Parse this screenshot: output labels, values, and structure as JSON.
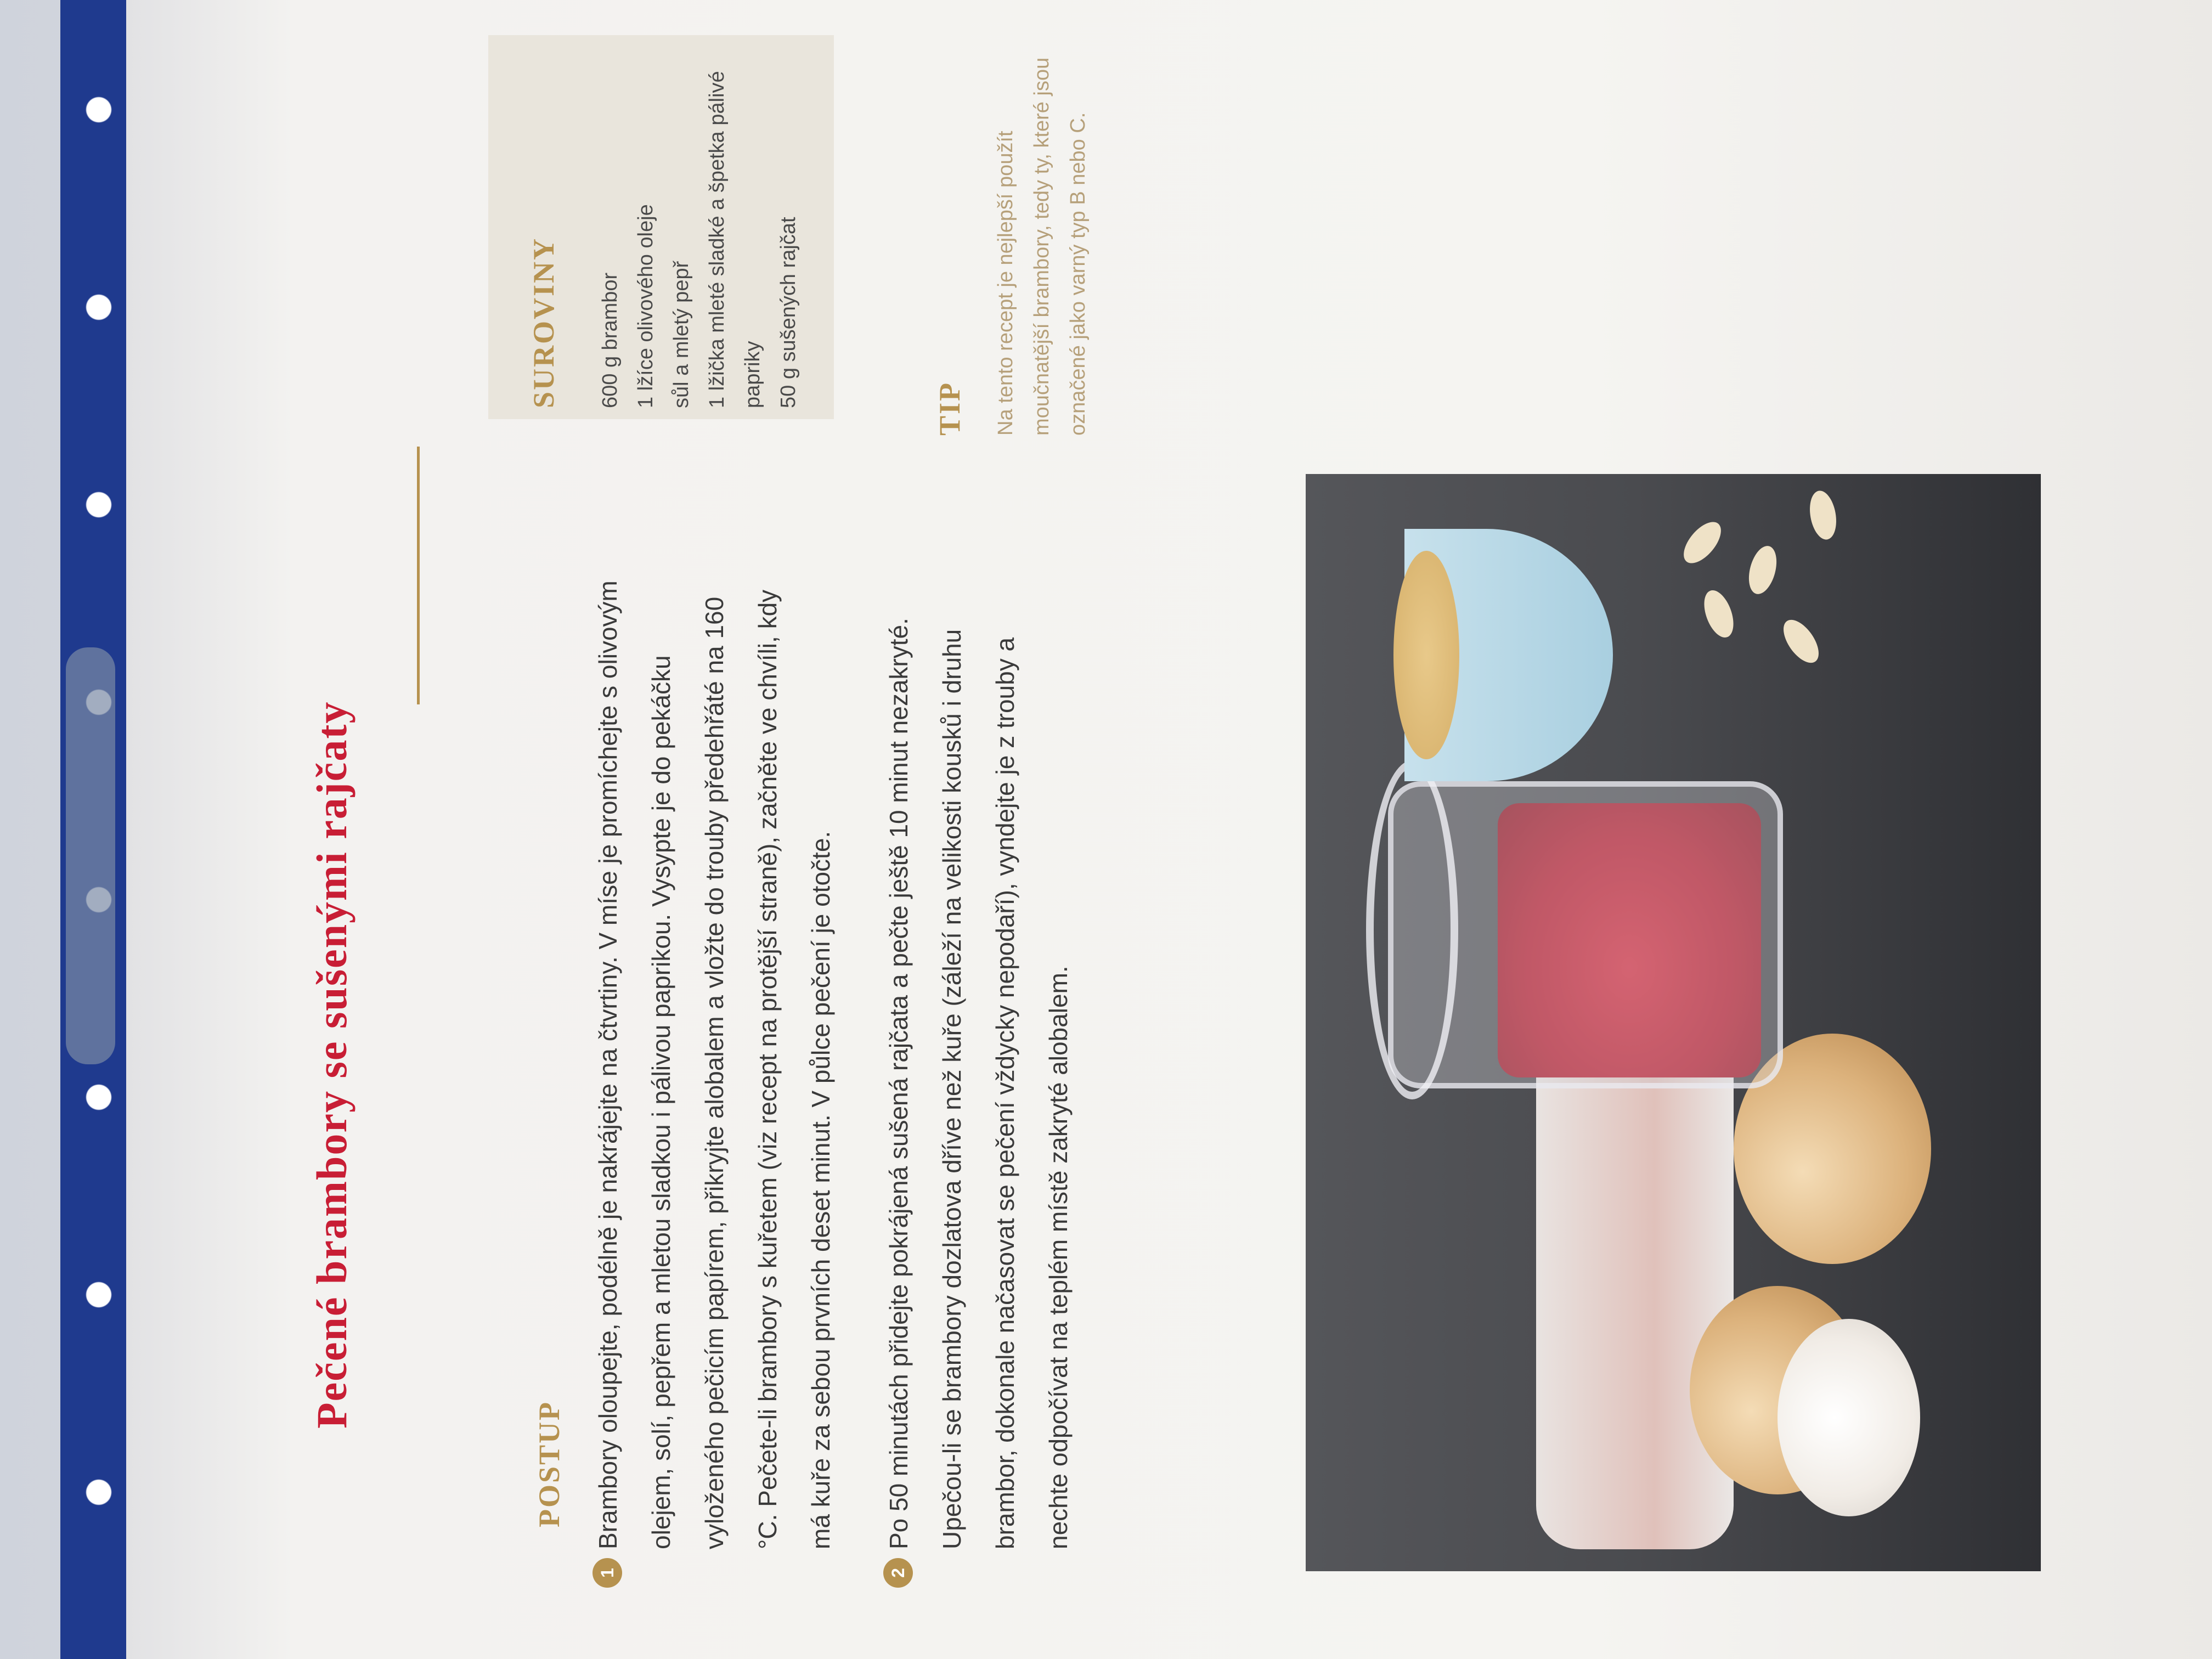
{
  "recipe": {
    "title": "Pečené brambory se sušenými rajčaty",
    "method": {
      "heading": "POSTUP",
      "steps": [
        {
          "number": "1",
          "text": "Brambory oloupejte, podélně je nakrájejte na čtvrtiny. V míse je promíchejte s olivovým olejem, solí, pepřem a mletou sladkou i pálivou paprikou. Vysypte je do pekáčku vyloženého pečicím papírem, přikryjte alobalem a vložte do trouby předehřáté na 160 °C. Pečete-li brambory s kuřetem (viz recept na protější straně), začněte ve chvíli, kdy má kuře za sebou prvních deset minut. V půlce pečení je otočte."
        },
        {
          "number": "2",
          "text": "Po 50 minutách přidejte pokrájená sušená rajčata a pečte ještě 10 minut nezakryté. Upečou-li se brambory dozlatova dříve než kuře (záleží na velikosti kousků i druhu brambor, dokonale načasovat se pečení vždycky nepodaří), vyndejte je z trouby a nechte odpočívat na teplém místě zakryté alobalem."
        }
      ]
    },
    "ingredients": {
      "heading": "SUROVINY",
      "items": [
        "600 g brambor",
        "1 lžíce olivového oleje",
        "sůl a mletý pepř",
        "1 lžička mleté sladké a špetka pálivé papriky",
        "50 g sušených rajčat"
      ]
    },
    "tip": {
      "heading": "TIP",
      "text": "Na tento recept je nejlepší použít moučnatější brambory, tedy ty, které jsou označené jako varný typ B nebo C."
    }
  },
  "colors": {
    "title": "#c81e35",
    "accent": "#b6924f",
    "body_text": "#3a3a3a",
    "ingredients_box": "#e9e5dc"
  }
}
